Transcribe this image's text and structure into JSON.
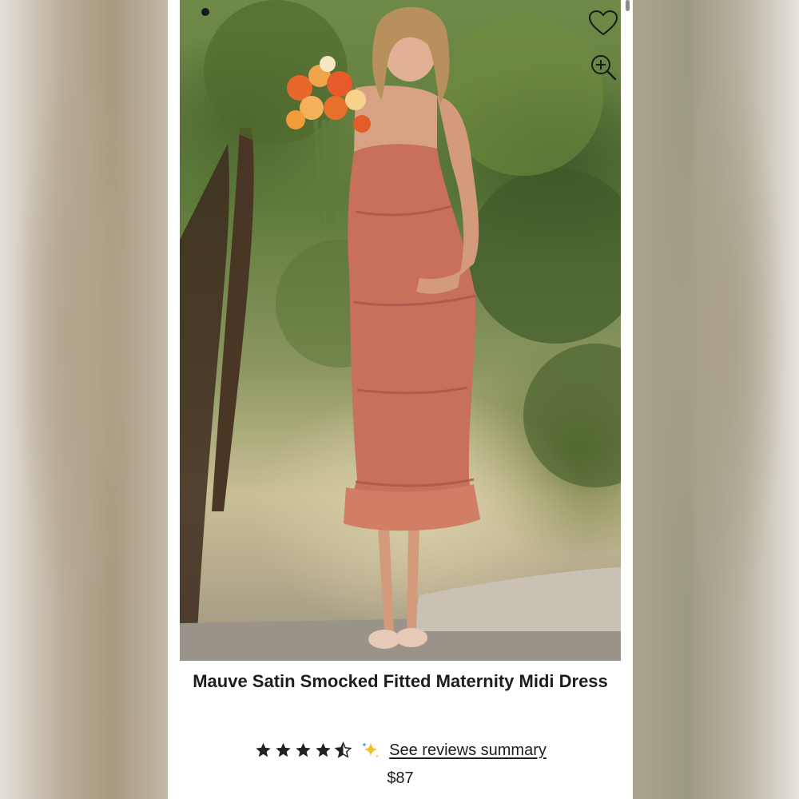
{
  "product": {
    "title": "Mauve Satin Smocked Fitted Maternity Midi Dress",
    "price": "$87",
    "rating": 4.5,
    "rating_max": 5,
    "reviews_link": "See reviews summary"
  },
  "gallery": {
    "favorite_icon": "heart-outline-icon",
    "zoom_icon": "zoom-in-icon",
    "image_description": "product-photo",
    "pagination_active_index": 1
  },
  "colors": {
    "dress": "#c8705c",
    "text": "#1d1d1d",
    "sparkle": "#f2c12e"
  }
}
